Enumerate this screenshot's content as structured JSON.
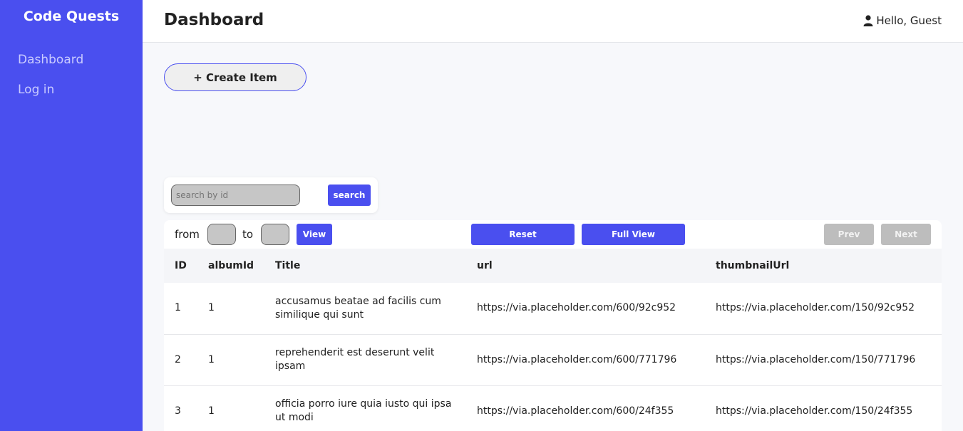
{
  "sidebar": {
    "brand": "Code Quests",
    "items": [
      {
        "label": "Dashboard"
      },
      {
        "label": "Log in"
      }
    ]
  },
  "header": {
    "title": "Dashboard",
    "greeting": "Hello, Guest"
  },
  "create_button": "+ Create Item",
  "search": {
    "placeholder": "search by id",
    "button": "search"
  },
  "toolbar": {
    "from_label": "from",
    "to_label": "to",
    "view_button": "View",
    "reset_button": "Reset",
    "full_view_button": "Full View",
    "prev_button": "Prev",
    "next_button": "Next"
  },
  "table": {
    "columns": [
      "ID",
      "albumId",
      "Title",
      "url",
      "thumbnailUrl"
    ],
    "rows": [
      [
        "1",
        "1",
        "accusamus beatae ad facilis cum similique qui sunt",
        "https://via.placeholder.com/600/92c952",
        "https://via.placeholder.com/150/92c952"
      ],
      [
        "2",
        "1",
        "reprehenderit est deserunt velit ipsam",
        "https://via.placeholder.com/600/771796",
        "https://via.placeholder.com/150/771796"
      ],
      [
        "3",
        "1",
        "officia porro iure quia iusto qui ipsa ut modi",
        "https://via.placeholder.com/600/24f355",
        "https://via.placeholder.com/150/24f355"
      ]
    ]
  },
  "colors": {
    "accent": "#4a4fef",
    "disabled": "#bdbdbd"
  },
  "icons": {
    "user": "user-icon"
  }
}
